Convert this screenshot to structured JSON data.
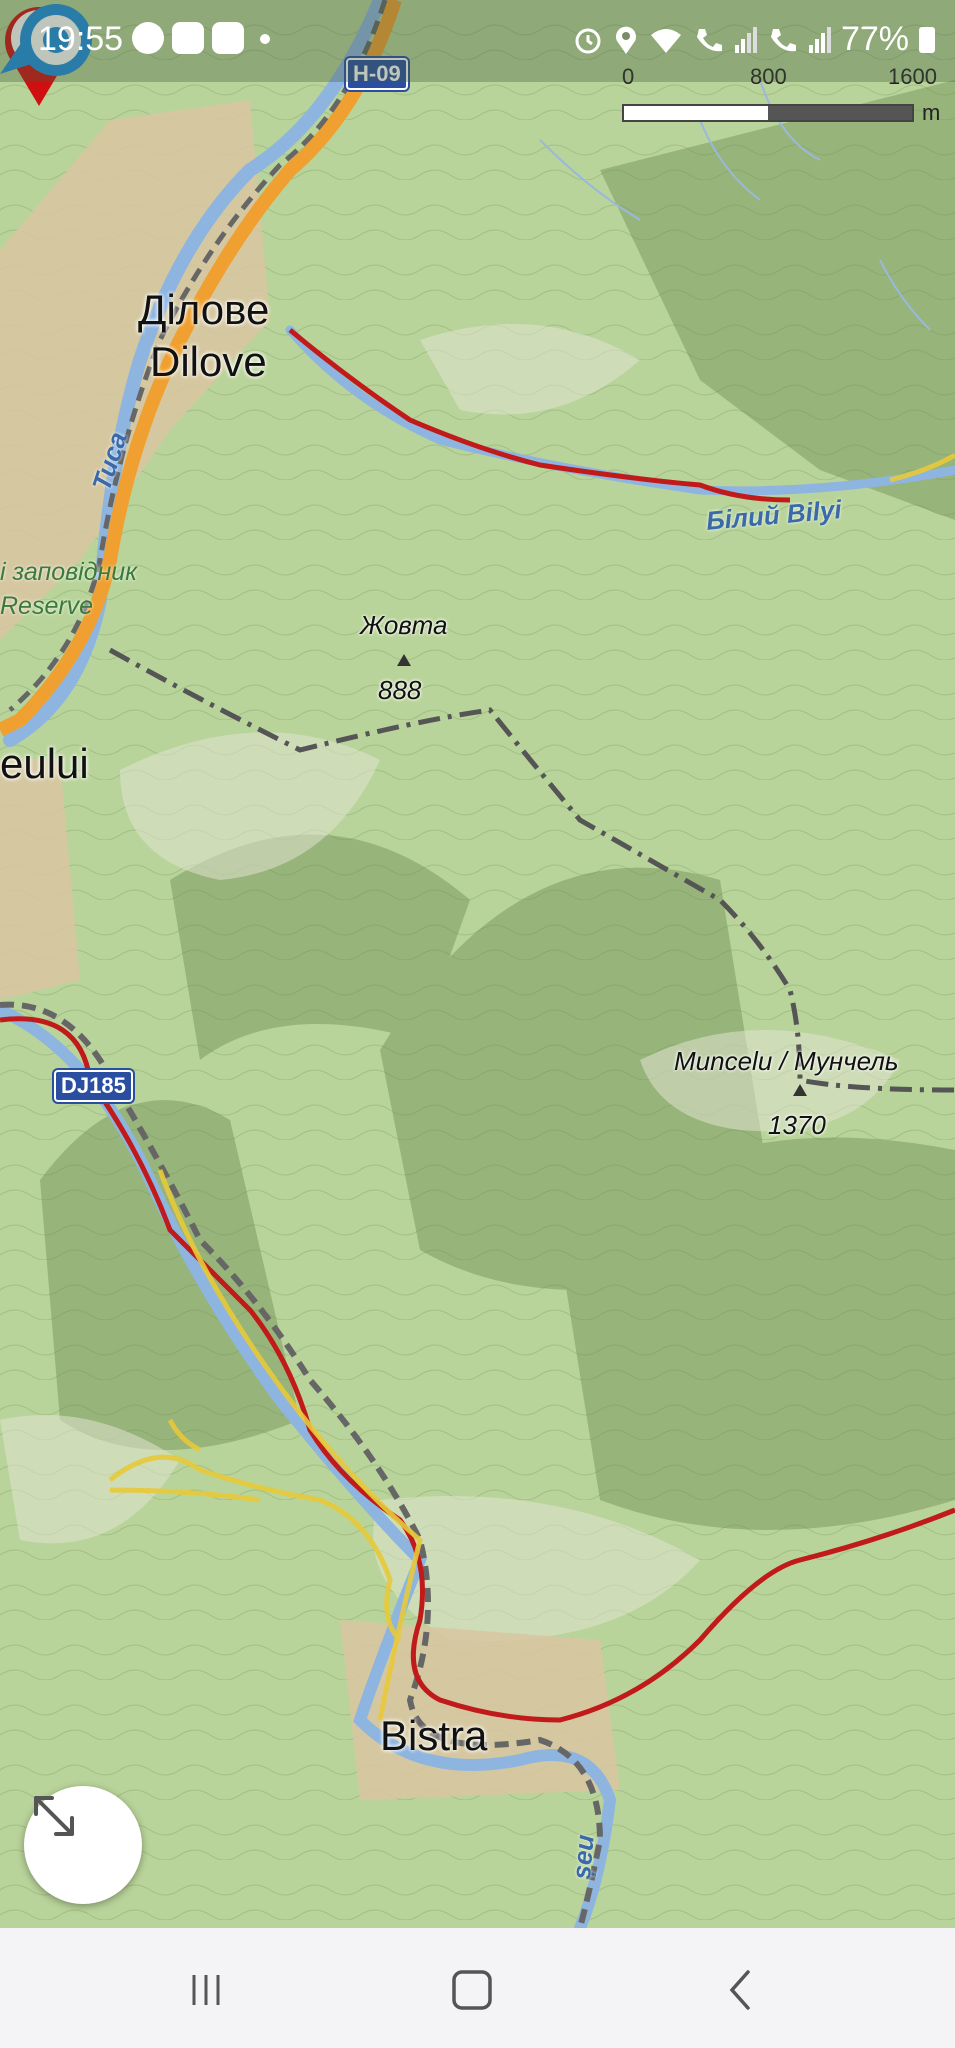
{
  "status_bar": {
    "time": "19:55",
    "battery": "77%",
    "notification_icons": [
      "messenger-icon",
      "youtube-icon",
      "youtube-icon"
    ],
    "system_icons": [
      "alarm-icon",
      "location-icon",
      "wifi-icon",
      "call-sim1-icon",
      "signal-icon",
      "call-sim2-icon",
      "signal-icon"
    ]
  },
  "scale_bar": {
    "labels": [
      "0",
      "800",
      "1600"
    ],
    "unit": "m"
  },
  "map": {
    "road_shields": [
      {
        "ref": "H-09"
      },
      {
        "ref": "DJ185"
      }
    ],
    "places": {
      "dilove_uk": "Ділове",
      "dilove_en": "Dilove",
      "bistra": "Bistra",
      "ceului": "eului"
    },
    "reserve": {
      "line1": "і заповідник",
      "line2": "Reserve"
    },
    "rivers": {
      "tysa": "Тиса",
      "bilyi": "Білий  Bilyi",
      "viseu": "șeu"
    },
    "peaks": [
      {
        "name": "Жовта",
        "elevation": "888"
      },
      {
        "name": "Muncelu / Мунчель",
        "elevation": "1370"
      }
    ],
    "colors": {
      "forest": "#b9d49a",
      "major_road": "#f0a030",
      "secondary_road": "#c01a1a",
      "minor_road": "#f5e06a",
      "border": "#555555",
      "river": "#8eb5e0",
      "marker": "#d01010",
      "location": "#1a90e0"
    }
  },
  "controls": {
    "expand_icon": "expand-arrows-icon"
  },
  "nav_bar": {
    "buttons": [
      "recent-apps-icon",
      "home-icon",
      "back-icon"
    ]
  }
}
